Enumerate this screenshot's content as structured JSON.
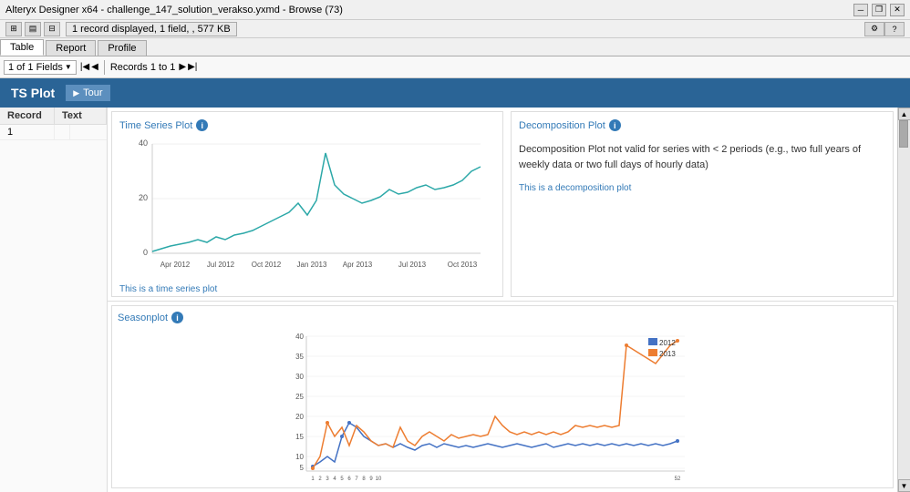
{
  "window": {
    "title": "Alteryx Designer x64 - challenge_147_solution_verakso.yxmd - Browse (73)",
    "info_bar": "1 record displayed, 1 field, , 577 KB"
  },
  "tabs": [
    {
      "label": "Table",
      "active": true
    },
    {
      "label": "Report",
      "active": false
    },
    {
      "label": "Profile",
      "active": false
    }
  ],
  "nav": {
    "fields": "1 of 1 Fields",
    "records": "Records 1 to 1"
  },
  "ts_plot": {
    "title": "TS Plot",
    "tour_label": "Tour"
  },
  "table": {
    "columns": [
      "Record",
      "Text"
    ],
    "rows": [
      {
        "record": "1",
        "text": ""
      }
    ]
  },
  "time_series_chart": {
    "title": "Time Series Plot",
    "note": "This is a time series plot",
    "x_labels": [
      "Apr 2012",
      "Jul 2012",
      "Oct 2012",
      "Jan 2013",
      "Apr 2013",
      "Jul 2013",
      "Oct 2013"
    ],
    "y_labels": [
      "40",
      "20",
      "0"
    ]
  },
  "seasonplot_chart": {
    "title": "Seasonplot",
    "note": "",
    "legend": [
      {
        "label": "2012",
        "color": "#4472c4"
      },
      {
        "label": "2013",
        "color": "#ed7d31"
      }
    ]
  },
  "decomposition": {
    "title": "Decomposition Plot",
    "message": "Decomposition Plot not valid for series with < 2 periods (e.g., two full years of weekly data or two full days of hourly data)",
    "note": "This is a decomposition plot"
  }
}
